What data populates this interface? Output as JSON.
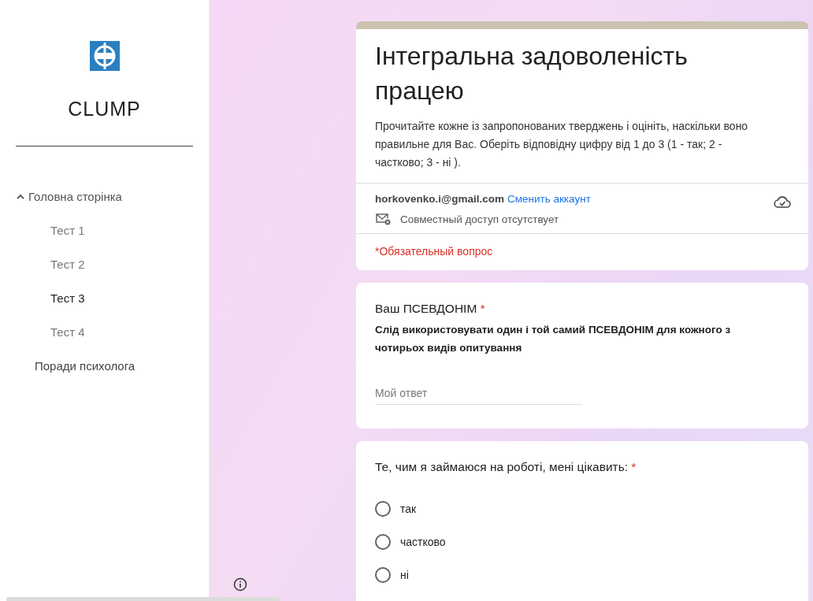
{
  "logo": {
    "title": "CLUMP"
  },
  "nav": [
    {
      "label": "Головна сторінка",
      "expanded": true,
      "selected": false,
      "children": [
        {
          "label": "Тест 1",
          "selected": false
        },
        {
          "label": "Тест 2",
          "selected": false
        },
        {
          "label": "Тест 3",
          "selected": true
        },
        {
          "label": "Тест 4",
          "selected": false
        }
      ]
    },
    {
      "label": "Поради психолога",
      "selected": false
    }
  ],
  "header_card": {
    "title": "Інтегральна задоволеність працею",
    "description": "Прочитайте кожне із запропонованих  тверджень і оцініть, наскільки воно правильне для Вас. Оберіть відповідну цифру від 1 до 3 (1 - так; 2 - частково; 3 - ні ).",
    "email": "horkovenko.i@gmail.com",
    "switch_account": "Сменить аккаунт",
    "sharing": "Совместный доступ отсутствует",
    "required_note": "*Обязательный вопрос"
  },
  "questions": [
    {
      "kind": "text",
      "title": "Ваш ПСЕВДОНІМ",
      "required_mark": "*",
      "hint": "Слід використовувати один і той самий ПСЕВДОНІМ для кожного з чотирьох видів опитування",
      "placeholder": "Мой ответ"
    },
    {
      "kind": "choice",
      "title": "Те, чим я займаюся на роботі, мені цікавить:",
      "required_mark": "*",
      "options": [
        {
          "label": "так",
          "selected": false
        },
        {
          "label": "частково",
          "selected": false
        },
        {
          "label": "ні",
          "selected": false
        }
      ]
    }
  ]
}
